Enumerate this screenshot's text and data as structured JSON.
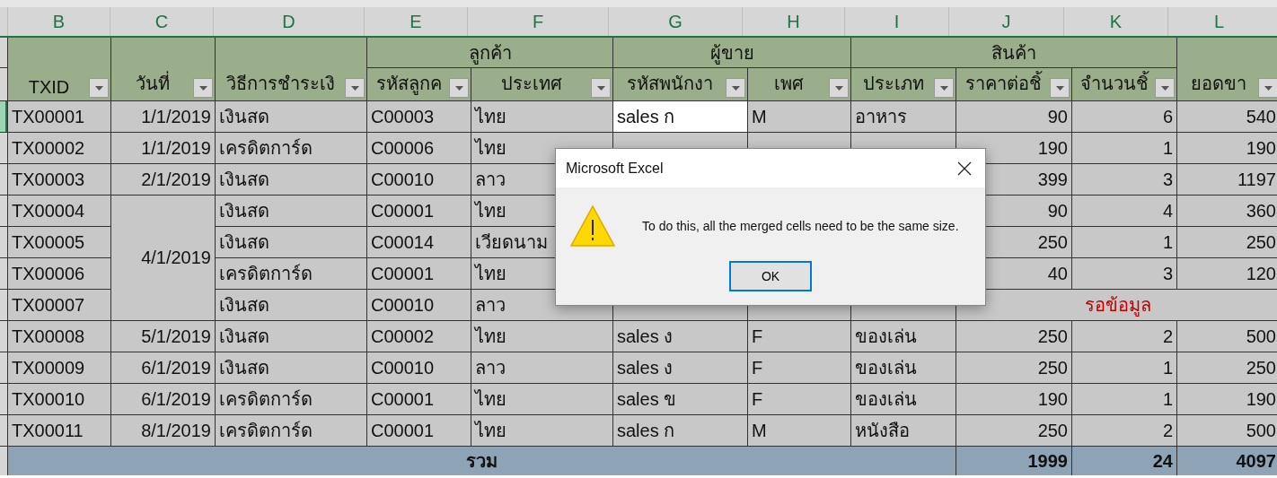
{
  "column_letters": [
    "B",
    "C",
    "D",
    "E",
    "F",
    "G",
    "H",
    "I",
    "J",
    "K",
    "L"
  ],
  "headers": [
    {
      "label": "TXID"
    },
    {
      "label": "วันที่"
    },
    {
      "label": "วิธีการชำระเงิ"
    },
    {
      "group": "ลูกค้า",
      "columns": [
        "รหัสลูกค",
        "ประเทศ"
      ]
    },
    {
      "group": "ผู้ขาย",
      "columns": [
        "รหัสพนักงา",
        "เพศ"
      ]
    },
    {
      "group": "สินค้า",
      "columns": [
        "ประเภท",
        "ราคาต่อชิ้",
        "จำนวนชิ้"
      ]
    },
    {
      "label": "ยอดขา"
    }
  ],
  "rows": [
    {
      "txid": "TX00001",
      "date": "1/1/2019",
      "method": "เงินสด",
      "customer": "C00003",
      "country": "ไทย",
      "sales": "sales ก",
      "sex": "M",
      "type": "อาหาร",
      "price": "90",
      "qty": "6",
      "total": "540",
      "selected": true
    },
    {
      "txid": "TX00002",
      "date": "1/1/2019",
      "method": "เครดิตการ์ด",
      "customer": "C00006",
      "country": "ไทย",
      "price": "190",
      "qty": "1",
      "total": "190",
      "selected": false
    },
    {
      "txid": "TX00003",
      "date": "2/1/2019",
      "method": "เงินสด",
      "customer": "C00010",
      "country": "ลาว",
      "price": "399",
      "qty": "3",
      "total": "1197",
      "selected": false
    },
    {
      "txid": "TX00004",
      "date": "4/1/2019",
      "method": "เงินสด",
      "customer": "C00001",
      "country": "ไทย",
      "price": "90",
      "qty": "4",
      "total": "360",
      "selected": false
    },
    {
      "txid": "TX00005",
      "method": "เงินสด",
      "customer": "C00014",
      "country": "เวียดนาม",
      "price": "250",
      "qty": "1",
      "total": "250",
      "selected": false
    },
    {
      "txid": "TX00006",
      "method": "เครดิตการ์ด",
      "customer": "C00001",
      "country": "ไทย",
      "price": "40",
      "qty": "3",
      "total": "120",
      "selected": false
    },
    {
      "txid": "TX00007",
      "method": "เงินสด",
      "customer": "C00010",
      "country": "ลาว",
      "note": "รอข้อมูล",
      "selected": false
    },
    {
      "txid": "TX00008",
      "date": "5/1/2019",
      "method": "เงินสด",
      "customer": "C00002",
      "country": "ไทย",
      "sales": "sales ง",
      "sex": "F",
      "type": "ของเล่น",
      "price": "250",
      "qty": "2",
      "total": "500",
      "selected": false
    },
    {
      "txid": "TX00009",
      "date": "6/1/2019",
      "method": "เงินสด",
      "customer": "C00010",
      "country": "ลาว",
      "sales": "sales ง",
      "sex": "F",
      "type": "ของเล่น",
      "price": "250",
      "qty": "1",
      "total": "250",
      "selected": false
    },
    {
      "txid": "TX00010",
      "date": "6/1/2019",
      "method": "เครดิตการ์ด",
      "customer": "C00001",
      "country": "ไทย",
      "sales": "sales ข",
      "sex": "F",
      "type": "ของเล่น",
      "price": "190",
      "qty": "1",
      "total": "190",
      "selected": false
    },
    {
      "txid": "TX00011",
      "date": "8/1/2019",
      "method": "เครดิตการ์ด",
      "customer": "C00001",
      "country": "ไทย",
      "sales": "sales ก",
      "sex": "M",
      "type": "หนังสือ",
      "price": "250",
      "qty": "2",
      "total": "500",
      "selected": false
    }
  ],
  "total_row": {
    "label": "รวม",
    "price": "1999",
    "qty": "24",
    "total": "4097"
  },
  "dialog": {
    "title": "Microsoft Excel",
    "message": "To do this, all the merged cells need to be the same size.",
    "button": "OK"
  }
}
